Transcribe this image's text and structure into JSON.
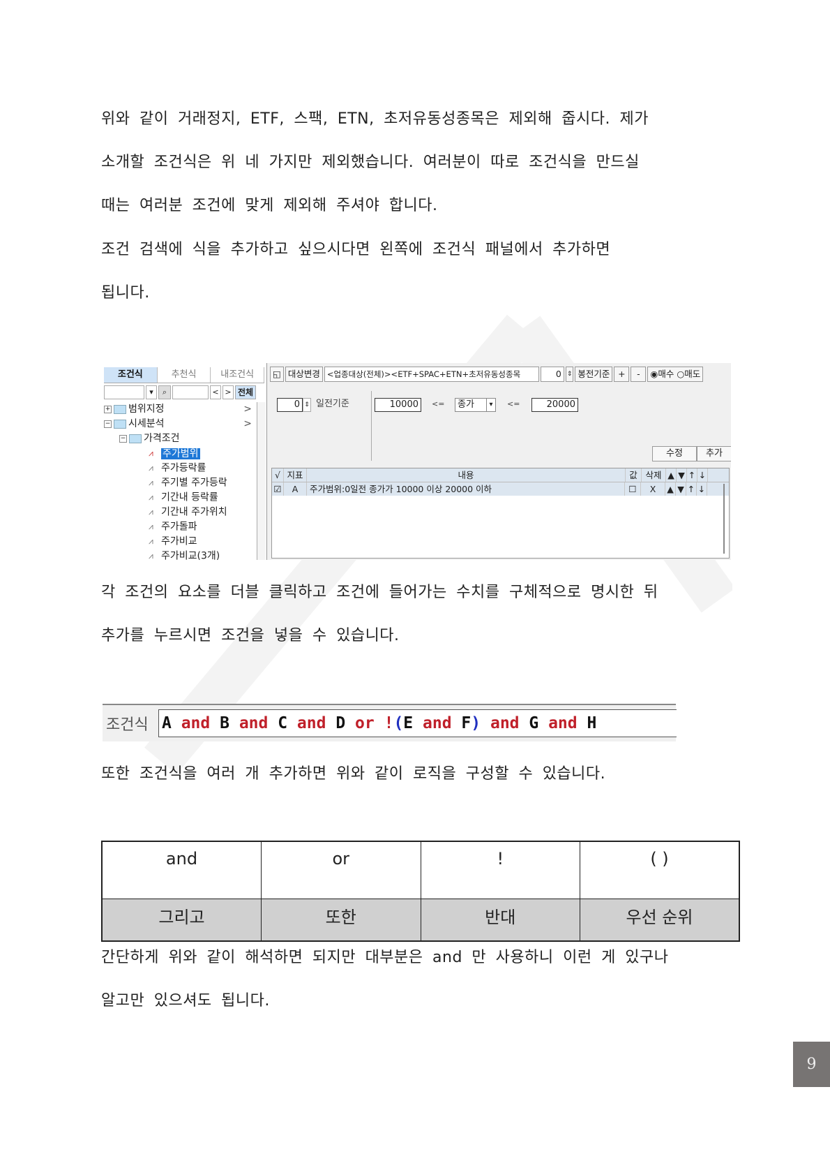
{
  "paragraphs_top": [
    "위와 같이 거래정지, ETF, 스팩, ETN, 초저유동성종목은 제외해 줍시다. 제가",
    "소개할 조건식은 위 네 가지만 제외했습니다. 여러분이 따로 조건식을 만드실",
    "때는 여러분 조건에 맞게 제외해 주셔야 합니다.",
    "조건 검색에 식을 추가하고 싶으시다면 왼쪽에 조건식 패널에서 추가하면",
    "됩니다."
  ],
  "screenshot": {
    "left_panel": {
      "tabs": [
        "조건식",
        "추천식",
        "내조건식"
      ],
      "active_tab": "조건식",
      "search_buttons": {
        "prev": "<",
        "next": ">",
        "all": "전체"
      },
      "tree": [
        {
          "label": "범위지정",
          "level": 0,
          "type": "folder",
          "expander": "+",
          "arrow": ">"
        },
        {
          "label": "시세분석",
          "level": 0,
          "type": "folder",
          "expander": "-",
          "arrow": ">"
        },
        {
          "label": "가격조건",
          "level": 1,
          "type": "folder",
          "expander": "-"
        },
        {
          "label": "주가범위",
          "level": 2,
          "type": "item",
          "selected": true
        },
        {
          "label": "주가등락률",
          "level": 2,
          "type": "item"
        },
        {
          "label": "주기별 주가등락",
          "level": 2,
          "type": "item"
        },
        {
          "label": "기간내 등락률",
          "level": 2,
          "type": "item"
        },
        {
          "label": "기간내 주가위치",
          "level": 2,
          "type": "item"
        },
        {
          "label": "주가돌파",
          "level": 2,
          "type": "item"
        },
        {
          "label": "주가비교",
          "level": 2,
          "type": "item"
        },
        {
          "label": "주가비교(3개)",
          "level": 2,
          "type": "item"
        }
      ]
    },
    "toolbar": {
      "change_target": "대상변경",
      "target_text": "<업종대상(전체)><ETF+SPAC+ETN+초저유동성종목",
      "spin_value": "0",
      "candle_basis": "봉전기준",
      "plus": "+",
      "minus": "-",
      "radio_buy": "매수",
      "radio_sell": "매도",
      "radio_selected": "매수"
    },
    "params": {
      "days_value": "0",
      "days_label": "일전기준",
      "min_value": "10000",
      "le1": "<=",
      "price_type": "종가",
      "le2": "<=",
      "max_value": "20000"
    },
    "buttons": {
      "edit": "수정",
      "add": "추가"
    },
    "grid": {
      "headers": [
        "√",
        "지표",
        "내용",
        "값",
        "삭제",
        "▲",
        "▼",
        "↑",
        "↓"
      ],
      "rows": [
        {
          "checked": true,
          "indicator": "A",
          "content": "주가범위:0일전 종가가 10000 이상 20000 이하",
          "value_checked": false,
          "delete": "X",
          "up": "▲",
          "down": "▼",
          "top": "↑",
          "bottom": "↓"
        }
      ]
    }
  },
  "paragraphs_mid": [
    "각 조건의 요소를 더블 클릭하고 조건에 들어가는 수치를 구체적으로 명시한 뒤",
    "추가를 누르시면 조건을 넣을 수 있습니다."
  ],
  "formula": {
    "label": "조건식",
    "tokens": [
      {
        "t": "A",
        "k": "var"
      },
      {
        "t": " and ",
        "k": "op"
      },
      {
        "t": "B",
        "k": "var"
      },
      {
        "t": " and ",
        "k": "op"
      },
      {
        "t": "C",
        "k": "var"
      },
      {
        "t": " and ",
        "k": "op"
      },
      {
        "t": "D",
        "k": "var"
      },
      {
        "t": " or ",
        "k": "op"
      },
      {
        "t": "!",
        "k": "op"
      },
      {
        "t": "(",
        "k": "par"
      },
      {
        "t": "E",
        "k": "var"
      },
      {
        "t": " and ",
        "k": "op"
      },
      {
        "t": "F",
        "k": "var"
      },
      {
        "t": ")",
        "k": "par"
      },
      {
        "t": " and ",
        "k": "op"
      },
      {
        "t": "G",
        "k": "var"
      },
      {
        "t": " and ",
        "k": "op"
      },
      {
        "t": "H",
        "k": "var"
      }
    ],
    "colors": {
      "var": "#111111",
      "op": "#c0202a",
      "par": "#2030c0"
    }
  },
  "paragraph_formula": "또한 조건식을 여러 개 추가하면 위와 같이 로직을 구성할 수 있습니다.",
  "operator_table": {
    "operators": [
      "and",
      "or",
      "!",
      "( )"
    ],
    "meanings": [
      "그리고",
      "또한",
      "반대",
      "우선 순위"
    ]
  },
  "paragraphs_bottom": [
    "간단하게 위와 같이 해석하면 되지만 대부분은 and 만 사용하니 이런 게 있구나",
    "알고만 있으셔도 됩니다."
  ],
  "page_number": "9"
}
